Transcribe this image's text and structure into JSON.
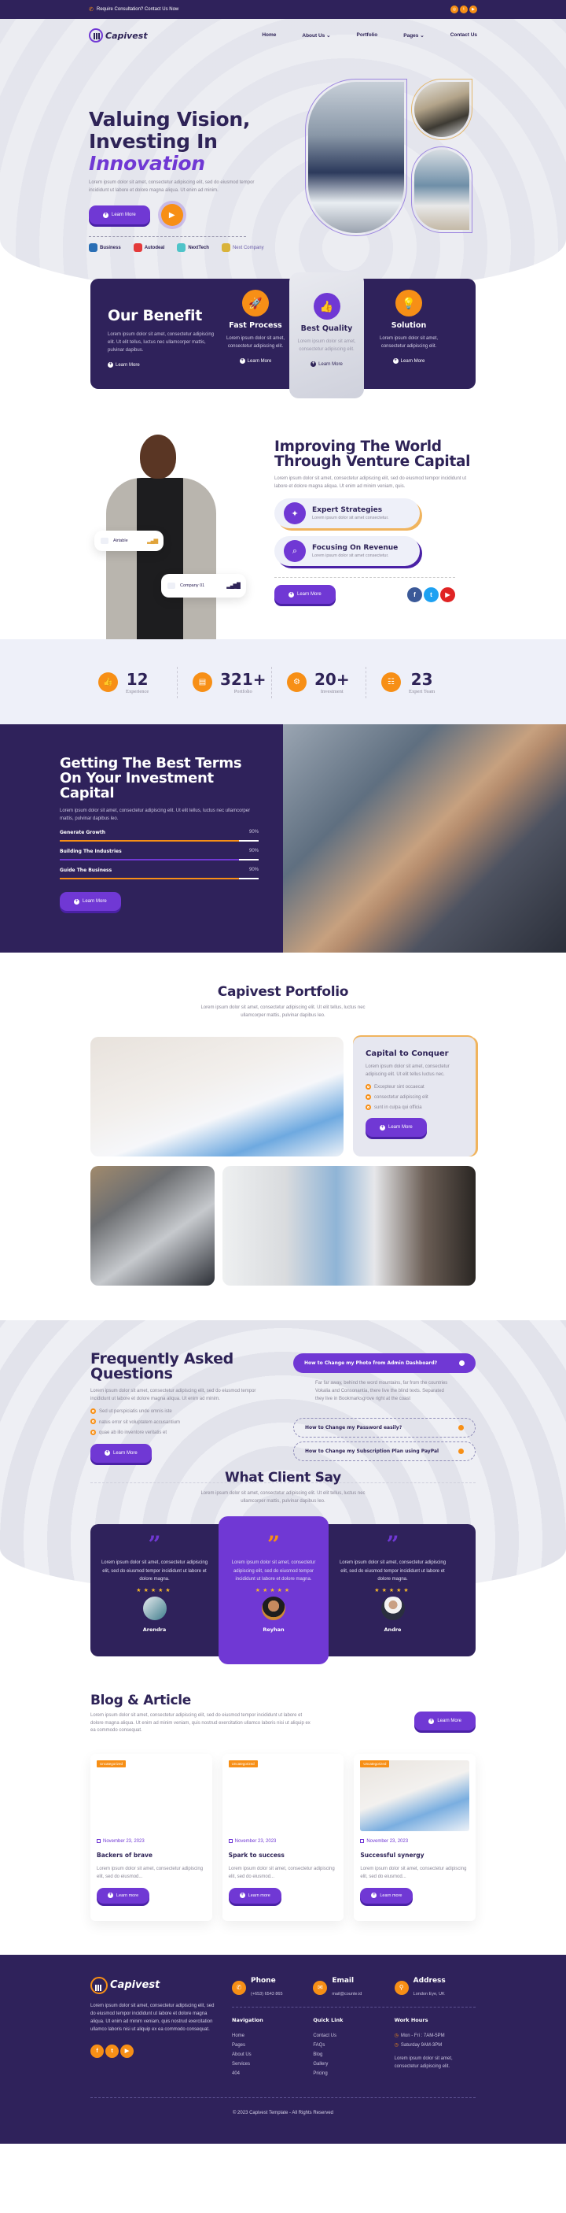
{
  "topbar": {
    "contact_text": "Require Consultation? Contact Us Now",
    "social_icons": [
      "instagram-icon",
      "twitter-icon",
      "youtube-icon"
    ]
  },
  "nav": {
    "brand": "Capivest",
    "links": [
      "Home",
      "About Us",
      "Portfolio",
      "Pages",
      "Contact Us"
    ]
  },
  "hero": {
    "title_line1": "Valuing Vision,",
    "title_line2": "Investing In",
    "title_accent": "Innovation",
    "description": "Lorem ipsum dolor sit amet, consectetur adipiscing elit, sed do eiusmod tempor incididunt ut labore et dolore magna aliqua. Ut enim ad minim.",
    "cta_label": "Learn More",
    "brands": [
      "Business",
      "Autodeal",
      "NextTech",
      "Next Company"
    ]
  },
  "benefit": {
    "title": "Our Benefit",
    "description": "Lorem ipsum dolor sit amet, consectetur adipiscing elit. Ut elit tellus, luctus nec ullamcorper mattis, pulvinar dapibus.",
    "link_label": "Learn More",
    "features": [
      {
        "title": "Fast Process",
        "text": "Lorem ipsum dolor sit amet, consectetur adipiscing elit.",
        "link": "Learn More",
        "icon": "rocket-icon"
      },
      {
        "title": "Best Quality",
        "text": "Lorem ipsum dolor sit amet, consectetur adipiscing elit.",
        "link": "Learn More",
        "icon": "thumbs-up-icon"
      },
      {
        "title": "Solution",
        "text": "Lorem ipsum dolor sit amet, consectetur adipiscing elit.",
        "link": "Learn More",
        "icon": "lightbulb-icon"
      }
    ]
  },
  "improve": {
    "chip1_label": "Airtable",
    "chip2_label": "Company 01",
    "title": "Improving The World Through Venture Capital",
    "description": "Lorem ipsum dolor sit amet, consectetur adipiscing elit, sed do eiusmod tempor incididunt ut labore et dolore magna aliqua. Ut enim ad minim veniam, quis.",
    "features": [
      {
        "title": "Expert Strategies",
        "text": "Lorem ipsum dolor sit amet consectetur.",
        "icon": "strategy-icon"
      },
      {
        "title": "Focusing On Revenue",
        "text": "Lorem ipsum dolor sit amet consectetur.",
        "icon": "magnifier-icon"
      }
    ],
    "cta_label": "Learn More",
    "social": [
      {
        "icon": "facebook-icon",
        "glyph": "f",
        "color": "#3b5998"
      },
      {
        "icon": "twitter-icon",
        "glyph": "t",
        "color": "#1da1f2"
      },
      {
        "icon": "youtube-icon",
        "glyph": "▶",
        "color": "#e02424"
      }
    ]
  },
  "stats": [
    {
      "value": "12",
      "label": "Experience",
      "icon": "thumbs-up-icon"
    },
    {
      "value": "321+",
      "label": "Portfolio",
      "icon": "book-icon"
    },
    {
      "value": "20+",
      "label": "Investment",
      "icon": "gear-icon"
    },
    {
      "value": "23",
      "label": "Expert Team",
      "icon": "team-icon"
    }
  ],
  "terms": {
    "title": "Getting The Best Terms On Your Investment Capital",
    "description": "Lorem ipsum dolor sit amet, consectetur adipiscing elit. Ut elit tellus, luctus nec ullamcorper mattis, pulvinar dapibus leo.",
    "bars": [
      {
        "label": "Generate Growth",
        "percent": 90,
        "display": "90%",
        "color": "#f78f16"
      },
      {
        "label": "Building The Industries",
        "percent": 90,
        "display": "90%",
        "color": "#7038d4"
      },
      {
        "label": "Guide The Business",
        "percent": 90,
        "display": "90%",
        "color": "#f78f16"
      }
    ],
    "cta_label": "Learn More"
  },
  "portfolio": {
    "title": "Capivest Portfolio",
    "subtitle": "Lorem ipsum dolor sit amet, consectetur adipiscing elit. Ut elit tellus, luctus nec ullamcorper mattis, pulvinar dapibus leo.",
    "card": {
      "title": "Capital to Conquer",
      "text": "Lorem ipsum dolor sit amet, consectetur adipiscing elit. Ut elit tellus luctus nec.",
      "bullets": [
        "Excepteur sint occaecat",
        "consectetur adipiscing elit",
        "sunt in culpa qui officia"
      ],
      "cta_label": "Learn More"
    }
  },
  "faq": {
    "title": "Frequently Asked Questions",
    "description": "Lorem ipsum dolor sit amet, consectetur adipiscing elit, sed do eiusmod tempor incididunt ut labore et dolore magna aliqua. Ut enim ad minim.",
    "bullets": [
      "Sed ut perspiciatis unde omnis iste",
      "natus error sit voluptatem accusantium",
      "quae ab illo inventore veritatis et"
    ],
    "cta_label": "Learn More",
    "items": [
      {
        "question": "How to Change my Photo from Admin Dashboard?",
        "answer": "Far far away, behind the word mountains, far from the countries Vokalia and Consonantia, there live the blind texts. Separated they live in Bookmarksgrove right at the coast",
        "open": true
      },
      {
        "question": "How to Change my Password easily?",
        "open": false
      },
      {
        "question": "How to Change my Subscription Plan using PayPal",
        "open": false
      }
    ]
  },
  "clients": {
    "title": "What Client Say",
    "subtitle": "Lorem ipsum dolor sit amet, consectetur adipiscing elit. Ut elit tellus, luctus nec ullamcorper mattis, pulvinar dapibus leo.",
    "items": [
      {
        "text": "Lorem ipsum dolor sit amet, consectetur adipiscing elit, sed do eiusmod tempor incididunt ut labore et dolore magna.",
        "rating": 5,
        "name": "Arendra"
      },
      {
        "text": "Lorem ipsum dolor sit amet, consectetur adipiscing elit, sed do eiusmod tempor incididunt ut labore et dolore magna.",
        "rating": 5,
        "name": "Reyhan"
      },
      {
        "text": "Lorem ipsum dolor sit amet, consectetur adipiscing elit, sed do eiusmod tempor incididunt ut labore et dolore magna.",
        "rating": 5,
        "name": "Andre"
      }
    ]
  },
  "blog": {
    "title": "Blog & Article",
    "description": "Lorem ipsum dolor sit amet, consectetur adipiscing elit, sed do eiusmod tempor incididunt ut labore et dolore magna aliqua. Ut enim ad minim veniam, quis nostrud exercitation ullamco laboris nisi ut aliquip ex ea commodo consequat.",
    "cta_label": "Learn More",
    "posts": [
      {
        "category": "Uncategorized",
        "date": "November 23, 2023",
        "title": "Backers of brave",
        "excerpt": "Lorem ipsum dolor sit amet, consectetur adipiscing elit, sed do eiusmod...",
        "cta": "Learn more"
      },
      {
        "category": "Uncategorized",
        "date": "November 23, 2023",
        "title": "Spark to success",
        "excerpt": "Lorem ipsum dolor sit amet, consectetur adipiscing elit, sed do eiusmod...",
        "cta": "Learn more"
      },
      {
        "category": "Uncategorized",
        "date": "November 23, 2023",
        "title": "Successful synergy",
        "excerpt": "Lorem ipsum dolor sit amet, consectetur adipiscing elit, sed do eiusmod...",
        "cta": "Learn more"
      }
    ]
  },
  "footer": {
    "brand": "Capivest",
    "description": "Lorem ipsum dolor sit amet, consectetur adipiscing elit, sed do eiusmod tempor incididunt ut labore et dolore magna aliqua. Ut enim ad minim veniam, quis nostrud exercitation ullamco laboris nisi ut aliquip ex ea commodo consequat.",
    "contacts": [
      {
        "title": "Phone",
        "value": "(+653) 6543 865",
        "icon": "phone-icon"
      },
      {
        "title": "Email",
        "value": "mail@counte.id",
        "icon": "mail-icon"
      },
      {
        "title": "Address",
        "value": "London Eye, UK",
        "icon": "location-icon"
      }
    ],
    "navigation": {
      "title": "Navigation",
      "links": [
        "Home",
        "Pages",
        "About Us",
        "Services",
        "404"
      ]
    },
    "quick_links": {
      "title": "Quick Link",
      "links": [
        "Contact Us",
        "FAQs",
        "Blog",
        "Gallery",
        "Pricing"
      ]
    },
    "work_hours": {
      "title": "Work Hours",
      "hours": [
        "Mon - Fri : 7AM-5PM",
        "Saturday 9AM-3PM"
      ],
      "note": "Lorem ipsum dolor sit amet, consectetur adipiscing elit."
    },
    "copyright": "© 2023 Capivest Template - All Rights Reserved"
  }
}
